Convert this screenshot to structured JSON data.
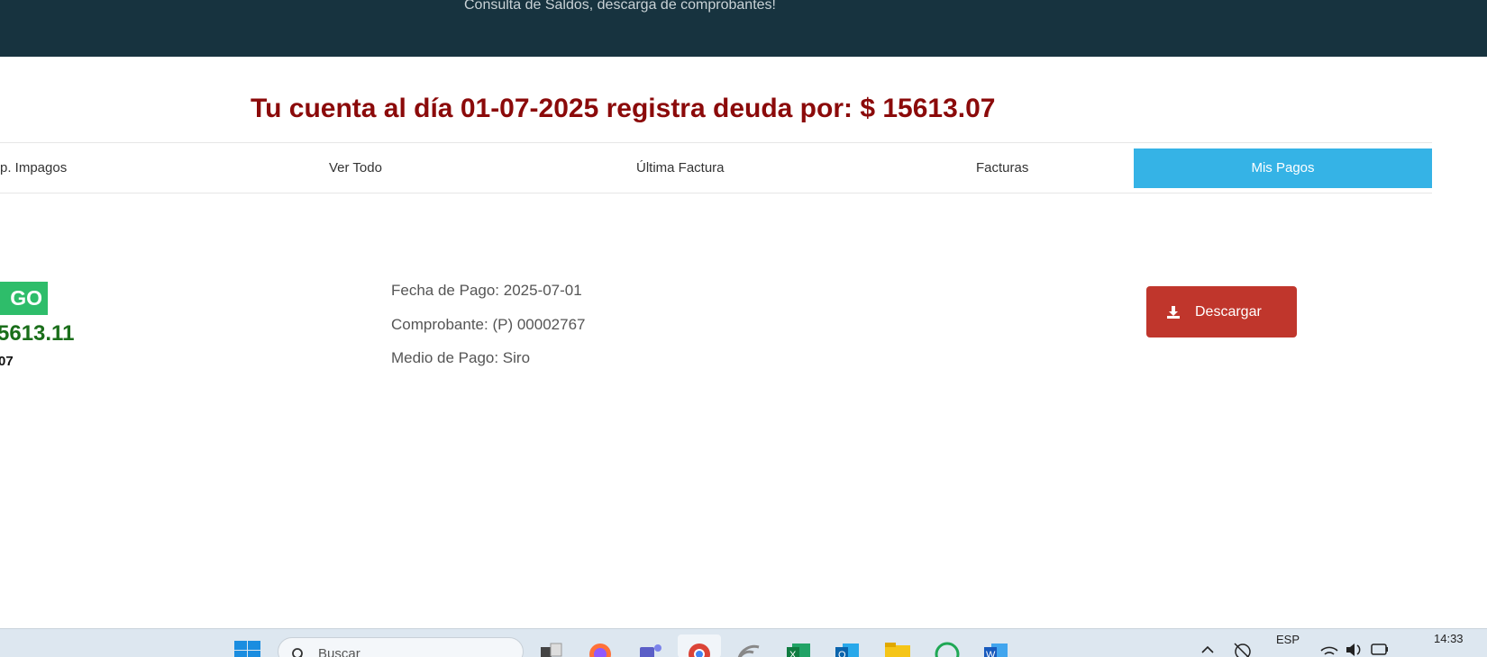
{
  "header": {
    "subtitle": "Consulta de Saldos, descarga de comprobantes!"
  },
  "debt_banner": {
    "text": "Tu cuenta al día 01-07-2025 registra deuda por: $ 15613.07"
  },
  "tabs": [
    {
      "label": "p. Impagos",
      "active": false
    },
    {
      "label": "Ver Todo",
      "active": false
    },
    {
      "label": "Última Factura",
      "active": false
    },
    {
      "label": "Facturas",
      "active": false
    },
    {
      "label": "Mis Pagos",
      "active": true
    }
  ],
  "payment": {
    "badge": "GO",
    "amount": "5613.11",
    "date_fragment": "07",
    "fecha_pago": "Fecha de Pago: 2025-07-01",
    "comprobante": "Comprobante: (P) 00002767",
    "medio_pago": "Medio de Pago: Siro",
    "download_label": "Descargar"
  },
  "taskbar": {
    "search_placeholder": "Buscar",
    "language": "ESP",
    "time": "14:33",
    "icons": [
      "windows-start-icon",
      "search-icon",
      "task-view-icon",
      "firefox-icon",
      "teams-icon",
      "chrome-icon",
      "rss-icon",
      "excel-icon",
      "outlook-icon",
      "file-explorer-icon",
      "whatsapp-icon",
      "word-icon",
      "tray-chevron-icon",
      "network-icon",
      "wifi-icon",
      "volume-icon",
      "battery-icon"
    ]
  },
  "colors": {
    "header_bg": "#17333f",
    "debt_text": "#8b0a0a",
    "active_tab": "#35b3e6",
    "badge": "#2ebd6a",
    "amount": "#1a6e1a",
    "download_button": "#c0362c"
  }
}
